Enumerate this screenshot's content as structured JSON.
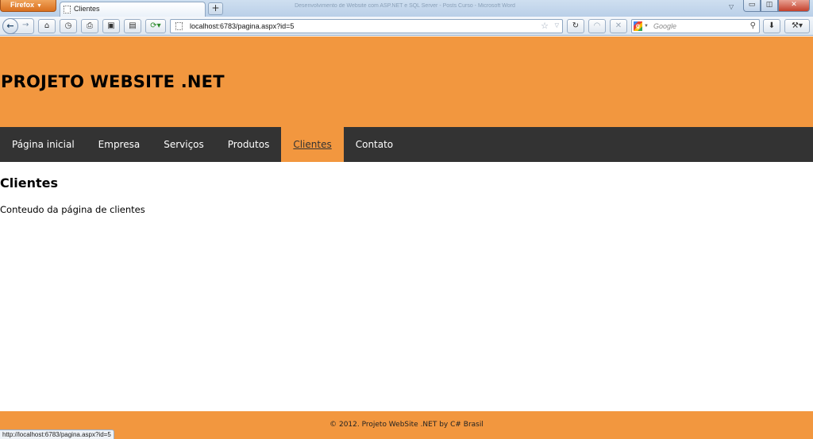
{
  "browser": {
    "app_menu_label": "Firefox",
    "window_title": "Desenvolvimento de Website com ASP.NET e SQL Server - Posts Curso - Microsoft Word",
    "tab_title": "Clientes",
    "new_tab_label": "+",
    "url": "localhost:6783/pagina.aspx?id=5",
    "search_placeholder": "Google",
    "status_url": "http://localhost:6783/pagina.aspx?id=5"
  },
  "site": {
    "title": "PROJETO WEBSITE .NET",
    "menu": [
      {
        "label": "Página inicial"
      },
      {
        "label": "Empresa"
      },
      {
        "label": "Serviços"
      },
      {
        "label": "Produtos"
      },
      {
        "label": "Clientes"
      },
      {
        "label": "Contato"
      }
    ],
    "active_menu": "Clientes",
    "page_title": "Clientes",
    "page_text": "Conteudo da página de clientes",
    "footer": "© 2012. Projeto WebSite .NET by C# Brasil"
  },
  "colors": {
    "accent": "#f2973f",
    "menu_bg": "#333333"
  }
}
